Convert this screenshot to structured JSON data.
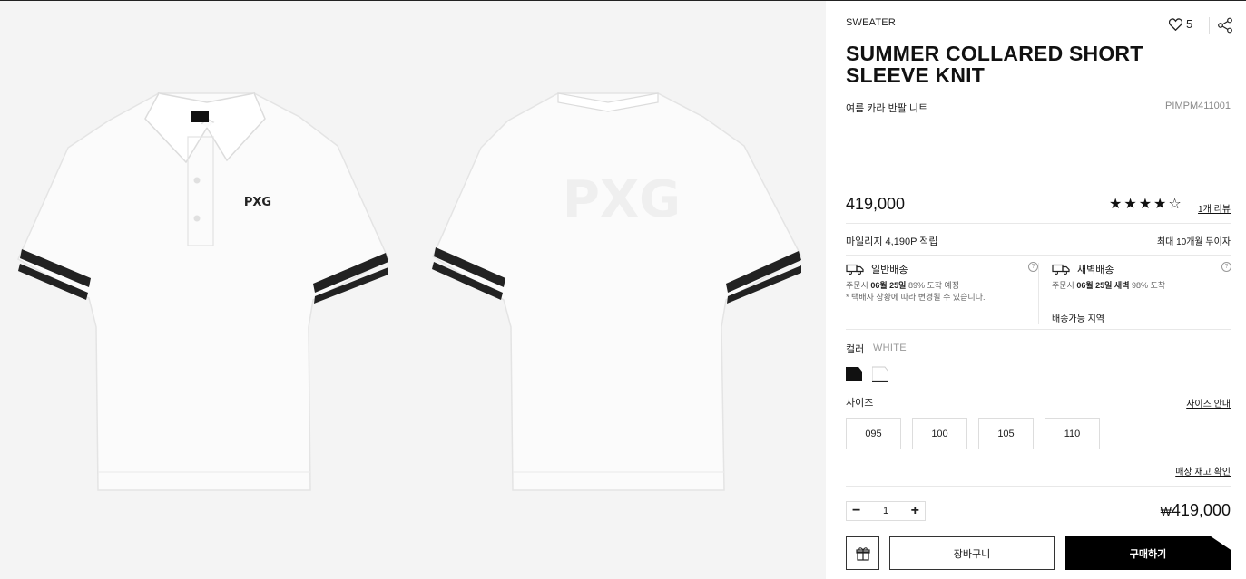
{
  "gallery": {
    "front_logo": "PXG",
    "back_logo": "PXG"
  },
  "product": {
    "category": "SWEATER",
    "likes": "5",
    "title": "SUMMER COLLARED SHORT SLEEVE KNIT",
    "subtitle": "여름 카라 반팔 니트",
    "code": "PIMPM411001",
    "price": "419,000",
    "rating": 4,
    "rating_max": 5,
    "review_link": "1개 리뷰"
  },
  "mileage": {
    "text": "마일리지 4,190P 적립",
    "coupon_link": "최대 10개월 무이자"
  },
  "shipping": {
    "normal": {
      "title": "일반배송",
      "line1_prefix": "주문시 ",
      "line1_bold": "06월 25일",
      "line1_suffix": " 89% 도착 예정",
      "line2": "* 택배사 상황에 따라 변경될 수 있습니다.",
      "help": "?"
    },
    "dawn": {
      "title": "새벽배송",
      "line1_prefix": "주문시 ",
      "line1_bold": "06월 25일 새벽",
      "line1_suffix": " 98% 도착",
      "help": "?",
      "area_link": "배송가능 지역"
    }
  },
  "color": {
    "label": "컬러",
    "value": "WHITE",
    "swatches": [
      "#111111",
      "#ffffff"
    ]
  },
  "size": {
    "label": "사이즈",
    "guide_link": "사이즈 안내",
    "options": [
      "095",
      "100",
      "105",
      "110"
    ]
  },
  "stock_link": "매장 재고 확인",
  "quantity": {
    "minus": "−",
    "value": "1",
    "plus": "+"
  },
  "total": {
    "currency": "₩",
    "amount": "419,000"
  },
  "actions": {
    "cart": "장바구니",
    "buy": "구매하기"
  }
}
